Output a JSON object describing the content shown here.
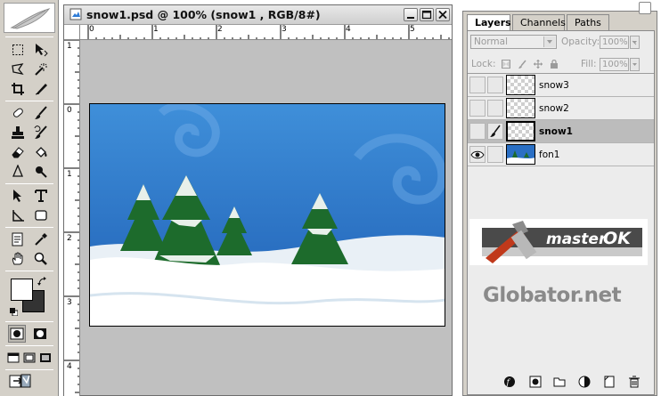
{
  "document": {
    "title": "snow1.psd @ 100% (snow1 , RGB/8#)",
    "ruler_h_labels": [
      "0",
      "1",
      "2",
      "3",
      "4",
      "5"
    ],
    "ruler_v_labels": [
      "1",
      "0",
      "1",
      "2",
      "3",
      "4"
    ]
  },
  "panel": {
    "tabs": [
      {
        "label": "Layers",
        "active": true
      },
      {
        "label": "Channels",
        "active": false
      },
      {
        "label": "Paths",
        "active": false
      }
    ],
    "blend_mode": "Normal",
    "opacity_label": "Opacity:",
    "opacity_value": "100%",
    "lock_label": "Lock:",
    "fill_label": "Fill:",
    "fill_value": "100%",
    "layers": [
      {
        "name": "snow3",
        "visible": false,
        "selected": false
      },
      {
        "name": "snow2",
        "visible": false,
        "selected": false
      },
      {
        "name": "snow1",
        "visible": false,
        "selected": true
      },
      {
        "name": "fon1",
        "visible": true,
        "selected": false
      }
    ]
  },
  "branding": {
    "masterok_text": "master",
    "masterok_emph": "OK",
    "globator": "Globator.net"
  },
  "colors": {
    "sky_top": "#1f5fb5",
    "sky_bottom": "#3f8fd9",
    "tree_green": "#1d6b2c",
    "selection_gray": "#bcbcbc"
  }
}
